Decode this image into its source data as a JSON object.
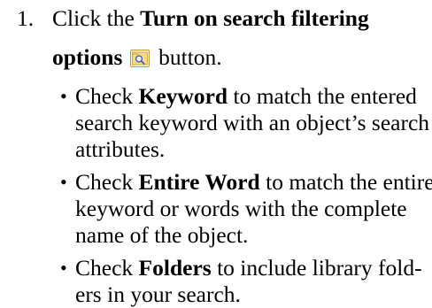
{
  "step": {
    "number": "1.",
    "text_click": "Click the",
    "button_name_line1": "Turn on search filtering",
    "button_name_line2": "options",
    "text_button": "button.",
    "icon": "search-filter-icon"
  },
  "bullets": [
    {
      "marker": "•",
      "pre": "Check",
      "term": "Keyword",
      "line1_rest": "to match the entered",
      "line2": "search keyword with an object’s search",
      "line3": "attributes."
    },
    {
      "marker": "•",
      "pre": "Check",
      "term": "Entire Word",
      "line1_rest": "to match the entire",
      "line2": "keyword or words with the complete",
      "line3": "name of the object."
    },
    {
      "marker": "•",
      "pre": "Check",
      "term": "Folders",
      "line1_rest": "to include library fold-",
      "line2": "ers in your search."
    }
  ],
  "colors": {
    "text": "#000000",
    "icon_frame": "#d9a347",
    "icon_fill": "#f6d88f",
    "icon_glass": "#3c5fa8"
  }
}
